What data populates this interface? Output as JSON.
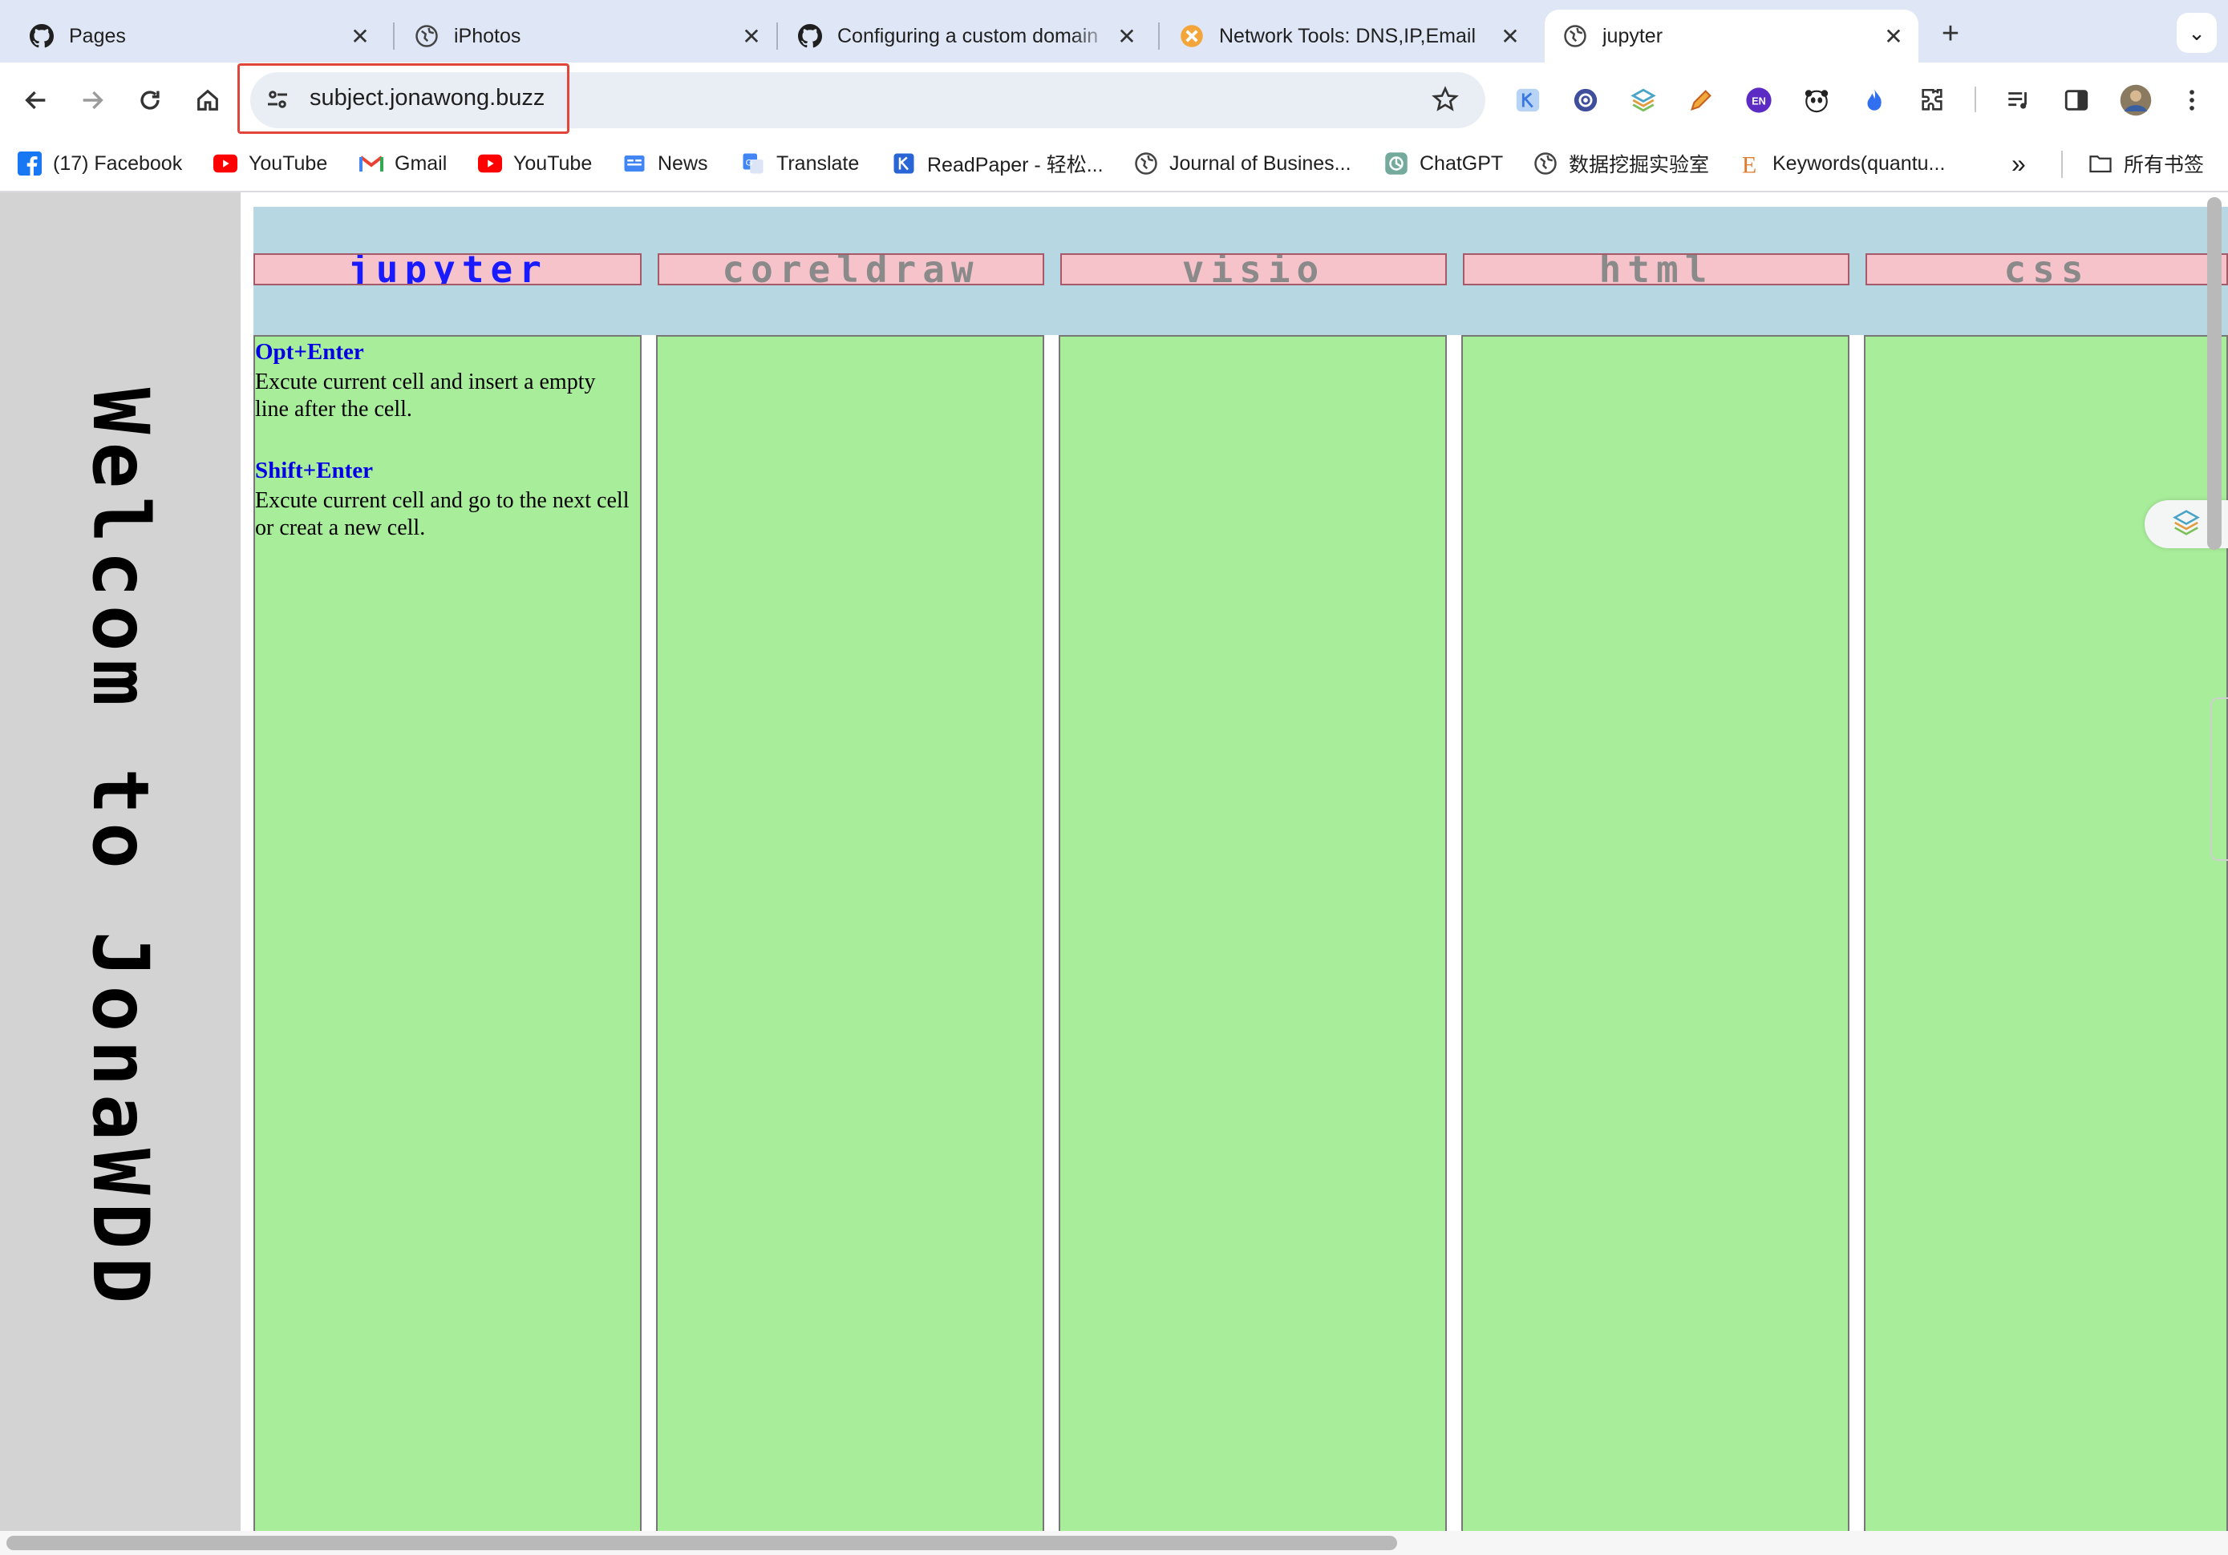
{
  "tabs": [
    {
      "title": "Pages",
      "icon": "github-icon",
      "active": false
    },
    {
      "title": "iPhotos",
      "icon": "globe-icon",
      "active": false
    },
    {
      "title": "Configuring a custom domain",
      "icon": "github-icon",
      "active": false
    },
    {
      "title": "Network Tools: DNS,IP,Email",
      "icon": "network-tools-icon",
      "active": false
    },
    {
      "title": "jupyter",
      "icon": "globe-icon",
      "active": true
    }
  ],
  "new_tab_label": "+",
  "address_bar": {
    "url": "subject.jonawong.buzz"
  },
  "bookmarks": [
    {
      "label": "(17) Facebook",
      "icon": "facebook-icon"
    },
    {
      "label": "YouTube",
      "icon": "youtube-icon"
    },
    {
      "label": "Gmail",
      "icon": "gmail-icon"
    },
    {
      "label": "YouTube",
      "icon": "youtube-icon"
    },
    {
      "label": "News",
      "icon": "news-icon"
    },
    {
      "label": "Translate",
      "icon": "translate-icon"
    },
    {
      "label": "ReadPaper - 轻松...",
      "icon": "readpaper-icon"
    },
    {
      "label": "Journal of Busines...",
      "icon": "globe-icon"
    },
    {
      "label": "ChatGPT",
      "icon": "chatgpt-icon"
    },
    {
      "label": "数据挖掘实验室",
      "icon": "globe-icon"
    },
    {
      "label": "Keywords(quantu...",
      "icon": "e-icon"
    }
  ],
  "bookmarks_overflow": "»",
  "all_bookmarks_label": "所有书签",
  "page": {
    "welcome_text": "Welcom to JonaWDD",
    "nav_buttons": [
      "jupyter",
      "coreldraw",
      "visio",
      "html",
      "css"
    ],
    "active_nav": "jupyter",
    "shortcuts": [
      {
        "key": "Opt+Enter",
        "description": "Excute current cell and insert a empty line after the cell."
      },
      {
        "key": "Shift+Enter",
        "description": "Excute current cell and go to the next cell or creat a new cell."
      }
    ]
  },
  "colors": {
    "banner": "#d3d3d3",
    "header_band": "#b7d7e2",
    "nav_button": "#f7c3cb",
    "column": "#a8ed9a",
    "active_text": "#1a1aff",
    "highlight_box": "#e0463a"
  }
}
